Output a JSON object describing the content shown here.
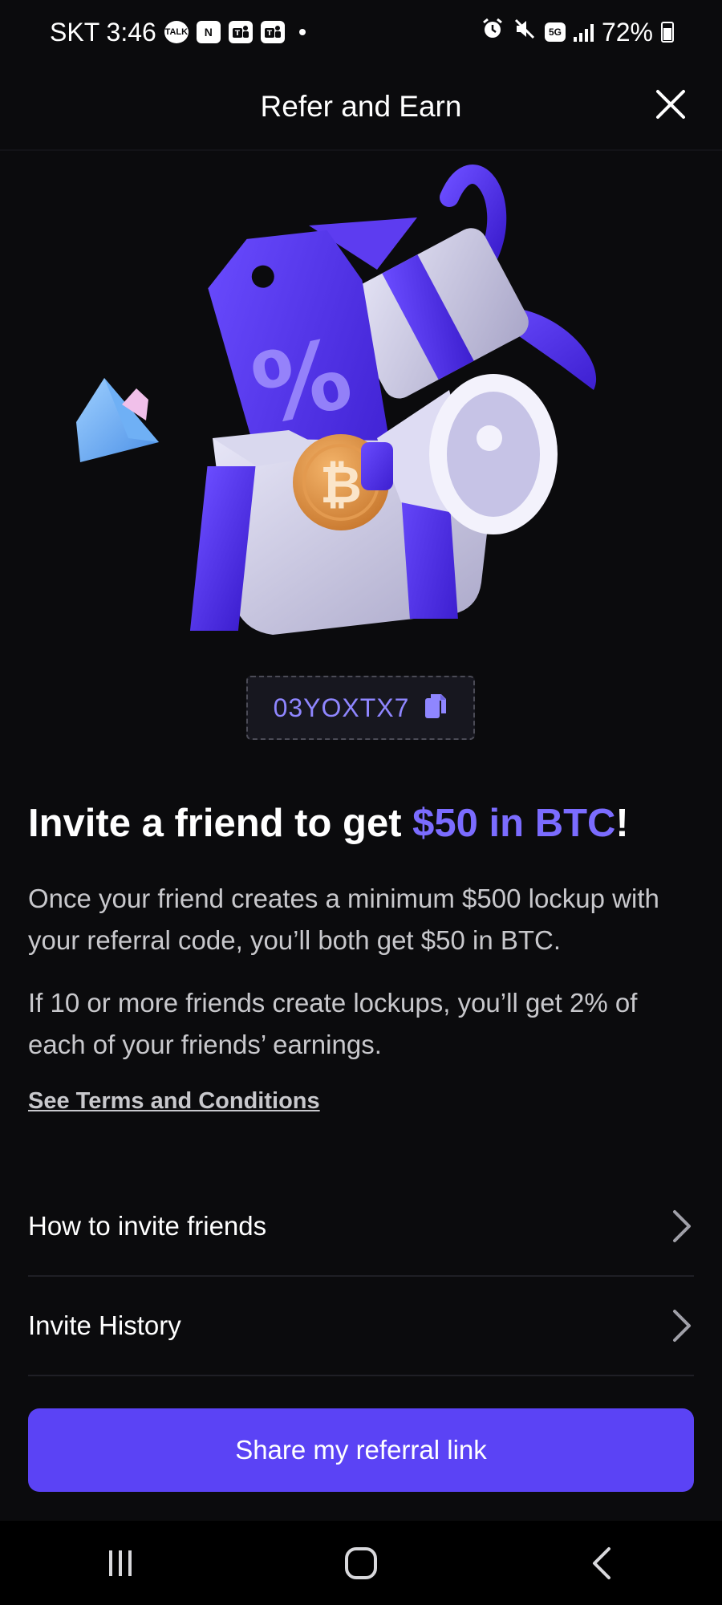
{
  "status_bar": {
    "carrier_time": "SKT 3:46",
    "icons": [
      "talk-icon",
      "naver-icon",
      "teams-icon",
      "teams-icon"
    ],
    "talk_label": "TALK",
    "naver_label": "N",
    "network_label": "5G",
    "battery": "72%"
  },
  "header": {
    "title": "Refer and Earn",
    "close_icon": "close-icon"
  },
  "hero": {
    "image": "gift-box-illustration"
  },
  "referral": {
    "code": "03YOXTX7",
    "copy_icon": "copy-icon"
  },
  "content": {
    "headline_prefix": "Invite a friend to get ",
    "headline_accent": "$50 in BTC",
    "headline_suffix": "!",
    "paragraph_1": "Once your friend creates a minimum $500 lockup with your referral code, you’ll both get $50 in BTC.",
    "paragraph_2": "If 10 or more friends create lockups, you’ll get 2% of each of your friends’ earnings.",
    "terms_link": "See Terms and Conditions"
  },
  "list": {
    "items": [
      {
        "label": "How to invite friends"
      },
      {
        "label": "Invite History"
      }
    ]
  },
  "share_button": "Share my referral link",
  "nav": {
    "icons": [
      "recents-icon",
      "home-icon",
      "back-icon"
    ]
  },
  "colors": {
    "background": "#0b0b0d",
    "accent": "#7b6cff",
    "button": "#5b43f5"
  }
}
